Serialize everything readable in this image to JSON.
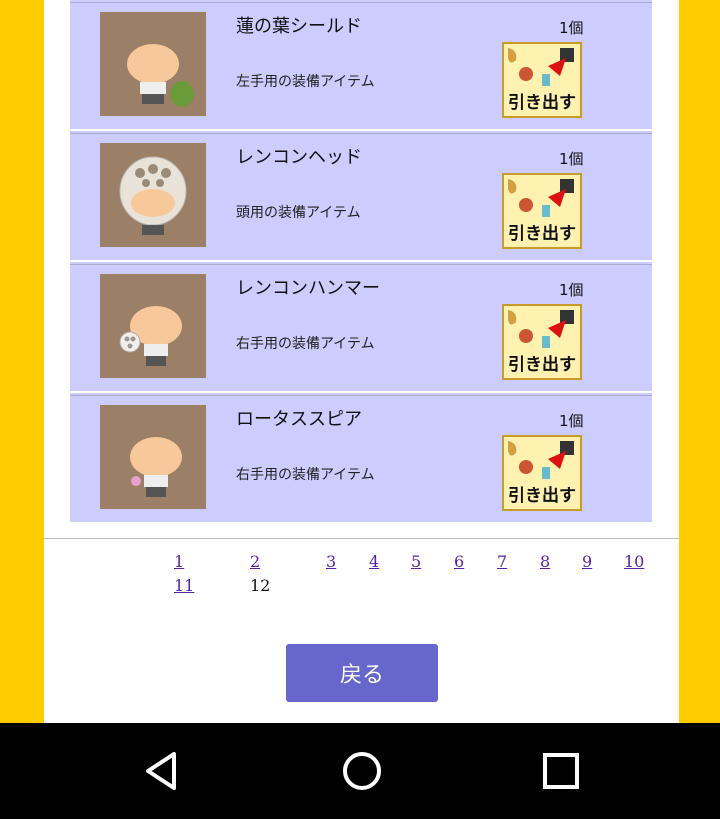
{
  "items": [
    {
      "name": "蓮の葉シールド",
      "count": "1個",
      "desc": "左手用の装備アイテム",
      "withdraw_label": "引き出す",
      "accessory": "lotus-leaf-shield-icon"
    },
    {
      "name": "レンコンヘッド",
      "count": "1個",
      "desc": "頭用の装備アイテム",
      "withdraw_label": "引き出す",
      "accessory": "lotus-root-head-icon"
    },
    {
      "name": "レンコンハンマー",
      "count": "1個",
      "desc": "右手用の装備アイテム",
      "withdraw_label": "引き出す",
      "accessory": "lotus-root-hammer-icon"
    },
    {
      "name": "ロータススピア",
      "count": "1個",
      "desc": "右手用の装備アイテム",
      "withdraw_label": "引き出す",
      "accessory": "lotus-spear-icon"
    }
  ],
  "pagination": {
    "pages": [
      "1",
      "2",
      "3",
      "4",
      "5",
      "6",
      "7",
      "8",
      "9",
      "10",
      "11"
    ],
    "current": "12"
  },
  "back_label": "戻る",
  "colors": {
    "frame": "#ffcc00",
    "row_bg": "#ccccff",
    "button": "#6666cc",
    "link": "#5522aa"
  }
}
